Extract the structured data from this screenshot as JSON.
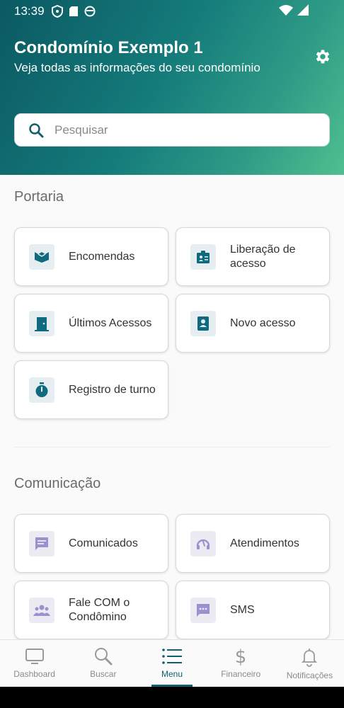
{
  "status_bar": {
    "time": "13:39"
  },
  "header": {
    "title": "Condomínio Exemplo 1",
    "subtitle": "Veja todas as informações do seu condomínio"
  },
  "search": {
    "placeholder": "Pesquisar"
  },
  "sections": {
    "portaria": {
      "title": "Portaria",
      "items": [
        {
          "label": "Encomendas",
          "icon": "package-icon"
        },
        {
          "label": "Liberação de acesso",
          "icon": "badge-icon"
        },
        {
          "label": "Últimos Acessos",
          "icon": "door-icon"
        },
        {
          "label": "Novo acesso",
          "icon": "id-card-icon"
        },
        {
          "label": "Registro de turno",
          "icon": "stopwatch-icon"
        }
      ]
    },
    "comunicacao": {
      "title": "Comunicação",
      "items": [
        {
          "label": "Comunicados",
          "icon": "message-icon"
        },
        {
          "label": "Atendimentos",
          "icon": "headset-icon"
        },
        {
          "label": "Fale COM o Condômino",
          "icon": "group-icon"
        },
        {
          "label": "SMS",
          "icon": "sms-icon"
        }
      ]
    }
  },
  "bottom_nav": [
    {
      "label": "Dashboard",
      "icon": "monitor-icon",
      "active": false
    },
    {
      "label": "Buscar",
      "icon": "search-icon",
      "active": false
    },
    {
      "label": "Menu",
      "icon": "list-icon",
      "active": true
    },
    {
      "label": "Financeiro",
      "icon": "dollar-icon",
      "active": false
    },
    {
      "label": "Notificações",
      "icon": "bell-icon",
      "active": false
    }
  ],
  "colors": {
    "accent": "#0f5f6e",
    "icon_teal": "#0f6a80",
    "icon_purple": "#9c91cf",
    "header_start": "#0b5962",
    "header_end": "#4fc08f"
  }
}
